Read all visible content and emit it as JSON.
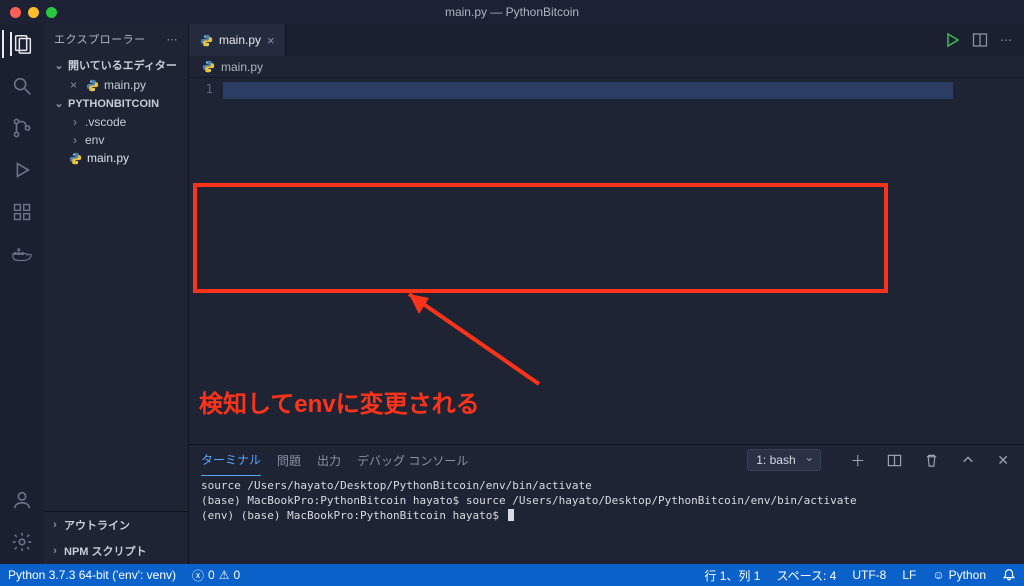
{
  "title": "main.py — PythonBitcoin",
  "explorer": {
    "header": "エクスプローラー",
    "open_editors_label": "開いているエディター",
    "open_editors": [
      {
        "name": "main.py"
      }
    ],
    "workspace": "PYTHONBITCOIN",
    "tree": {
      "vscode": ".vscode",
      "env": "env",
      "mainpy": "main.py"
    },
    "outline": "アウトライン",
    "npm": "NPM スクリプト"
  },
  "tabs": {
    "main": "main.py"
  },
  "breadcrumb": {
    "main": "main.py"
  },
  "editor": {
    "line1": "1"
  },
  "panel": {
    "tabs": {
      "terminal": "ターミナル",
      "problems": "問題",
      "output": "出力",
      "debug": "デバッグ コンソール"
    },
    "shell_selected": "1: bash",
    "terminal_lines": [
      "source /Users/hayato/Desktop/PythonBitcoin/env/bin/activate",
      "(base) MacBookPro:PythonBitcoin hayato$ source /Users/hayato/Desktop/PythonBitcoin/env/bin/activate",
      "(env) (base) MacBookPro:PythonBitcoin hayato$ "
    ]
  },
  "status": {
    "python": "Python 3.7.3 64-bit ('env': venv)",
    "errors": "0",
    "warnings": "0",
    "line_col": "行 1、列 1",
    "spaces": "スペース: 4",
    "encoding": "UTF-8",
    "eol": "LF",
    "lang": "Python"
  },
  "annotation": {
    "text": "検知してenvに変更される"
  }
}
